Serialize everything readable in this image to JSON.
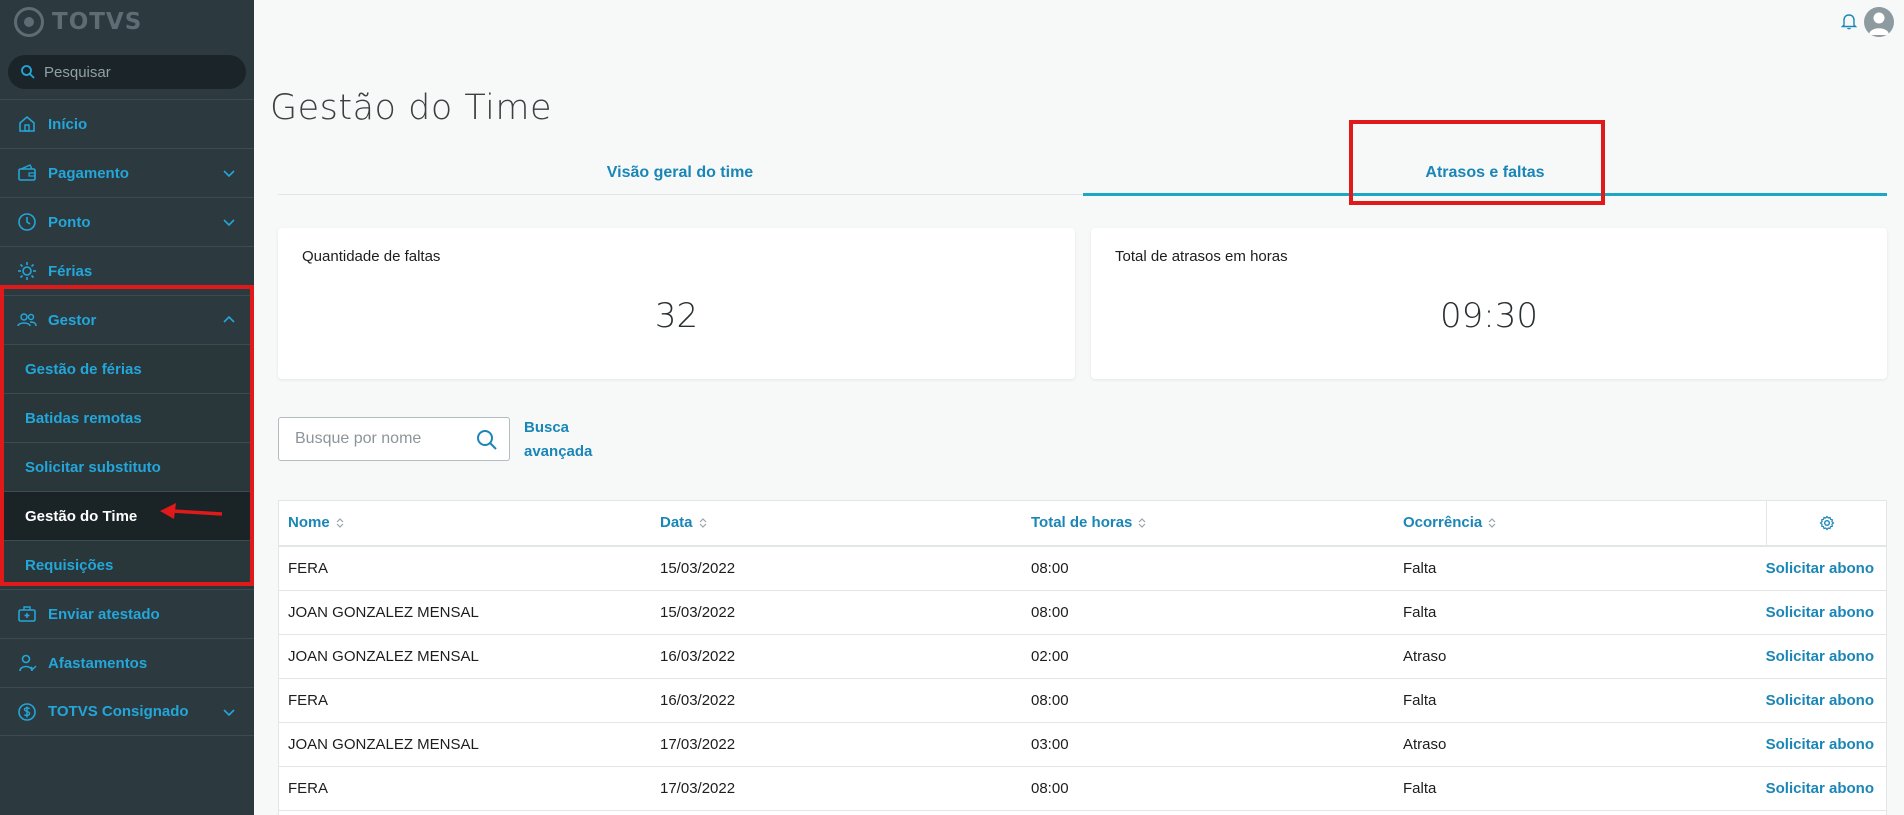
{
  "brand": {
    "name": "TOTVS"
  },
  "sidebar": {
    "search_placeholder": "Pesquisar",
    "items": [
      {
        "label": "Início",
        "icon": "home-icon"
      },
      {
        "label": "Pagamento",
        "icon": "wallet-icon"
      },
      {
        "label": "Ponto",
        "icon": "clock-icon"
      },
      {
        "label": "Férias",
        "icon": "sun-icon"
      },
      {
        "label": "Gestor",
        "icon": "users-icon"
      }
    ],
    "gestor_sub": [
      {
        "label": "Gestão de férias"
      },
      {
        "label": "Batidas remotas"
      },
      {
        "label": "Solicitar substituto"
      },
      {
        "label": "Gestão do Time"
      },
      {
        "label": "Requisições"
      }
    ],
    "bottom_items": [
      {
        "label": "Enviar atestado",
        "icon": "medical-kit-icon"
      },
      {
        "label": "Afastamentos",
        "icon": "person-icon"
      },
      {
        "label": "TOTVS Consignado",
        "icon": "dollar-icon"
      }
    ]
  },
  "page": {
    "title": "Gestão do Time",
    "tabs": [
      {
        "label": "Visão geral do time",
        "active": false
      },
      {
        "label": "Atrasos e faltas",
        "active": true
      }
    ]
  },
  "cards": [
    {
      "label": "Quantidade de faltas",
      "value": "32"
    },
    {
      "label": "Total de atrasos em horas",
      "value": "09:30"
    }
  ],
  "filter": {
    "placeholder": "Busque por nome",
    "advanced_line1": "Busca",
    "advanced_line2": "avançada"
  },
  "table": {
    "columns": [
      "Nome",
      "Data",
      "Total de horas",
      "Ocorrência"
    ],
    "action_label": "Solicitar abono",
    "rows": [
      {
        "nome": "FERA",
        "data": "15/03/2022",
        "horas": "08:00",
        "ocorrencia": "Falta"
      },
      {
        "nome": "JOAN GONZALEZ MENSAL",
        "data": "15/03/2022",
        "horas": "08:00",
        "ocorrencia": "Falta"
      },
      {
        "nome": "JOAN GONZALEZ MENSAL",
        "data": "16/03/2022",
        "horas": "02:00",
        "ocorrencia": "Atraso"
      },
      {
        "nome": "FERA",
        "data": "16/03/2022",
        "horas": "08:00",
        "ocorrencia": "Falta"
      },
      {
        "nome": "JOAN GONZALEZ MENSAL",
        "data": "17/03/2022",
        "horas": "03:00",
        "ocorrencia": "Atraso"
      },
      {
        "nome": "FERA",
        "data": "17/03/2022",
        "horas": "08:00",
        "ocorrencia": "Falta"
      }
    ]
  },
  "colors": {
    "accent": "#1a86b7",
    "sidebar_bg": "#2c3a3f",
    "annotation": "#e0191b"
  }
}
